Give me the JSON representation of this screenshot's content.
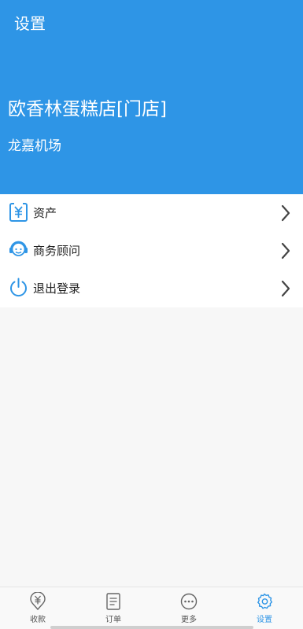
{
  "titlebar": {
    "title": "设置"
  },
  "header": {
    "store_name": "欧香林蛋糕店[门店]",
    "location": "龙嘉机场"
  },
  "menu": {
    "items": [
      {
        "label": "资产",
        "icon": "wallet-yuan-icon"
      },
      {
        "label": "商务顾问",
        "icon": "headset-advisor-icon"
      },
      {
        "label": "退出登录",
        "icon": "power-icon"
      }
    ]
  },
  "tabbar": {
    "tabs": [
      {
        "label": "收款",
        "icon": "yuan-location-icon",
        "active": false
      },
      {
        "label": "订单",
        "icon": "document-icon",
        "active": false
      },
      {
        "label": "更多",
        "icon": "more-dots-icon",
        "active": false
      },
      {
        "label": "设置",
        "icon": "gear-icon",
        "active": true
      }
    ]
  },
  "colors": {
    "primary": "#2e95e6",
    "background": "#f7f7f7",
    "tab_inactive": "#555555"
  }
}
